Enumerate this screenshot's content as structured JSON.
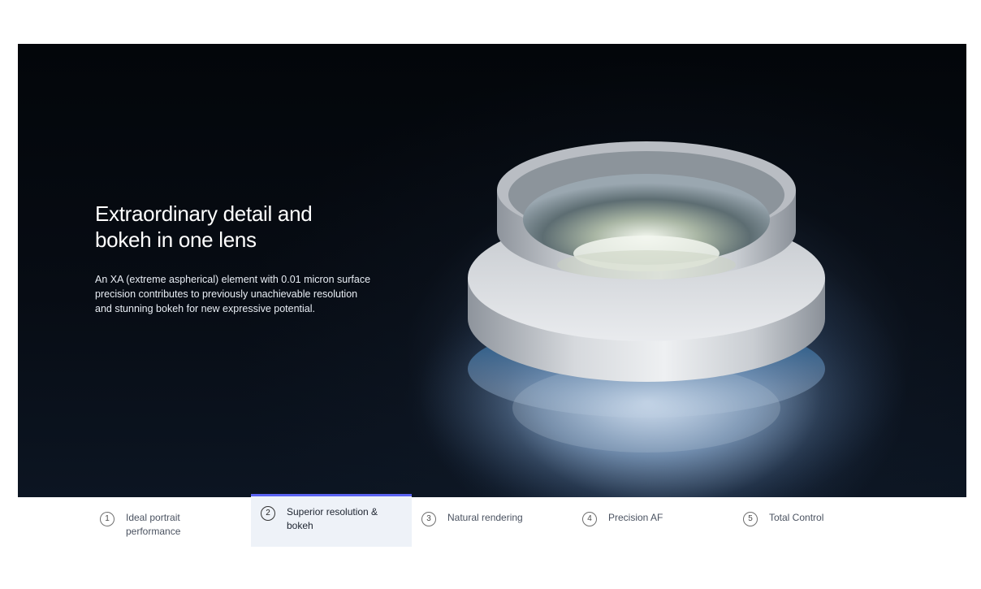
{
  "hero": {
    "title_line1": "Extraordinary detail and",
    "title_line2": "bokeh in one lens",
    "body": "An XA (extreme aspherical) element with 0.01 micron surface precision contributes to previously unachievable resolution and stunning bokeh for new expressive potential.",
    "image_subject": "aspherical lens element"
  },
  "tabs": [
    {
      "num": "1",
      "label": "Ideal portrait performance",
      "active": false
    },
    {
      "num": "2",
      "label": "Superior resolution & bokeh",
      "active": true
    },
    {
      "num": "3",
      "label": "Natural rendering",
      "active": false
    },
    {
      "num": "4",
      "label": "Precision AF",
      "active": false
    },
    {
      "num": "5",
      "label": "Total Control",
      "active": false
    }
  ],
  "colors": {
    "accent": "#5b63f2",
    "active_tab_bg": "#eef2f8",
    "hero_bg": "#05080e"
  }
}
